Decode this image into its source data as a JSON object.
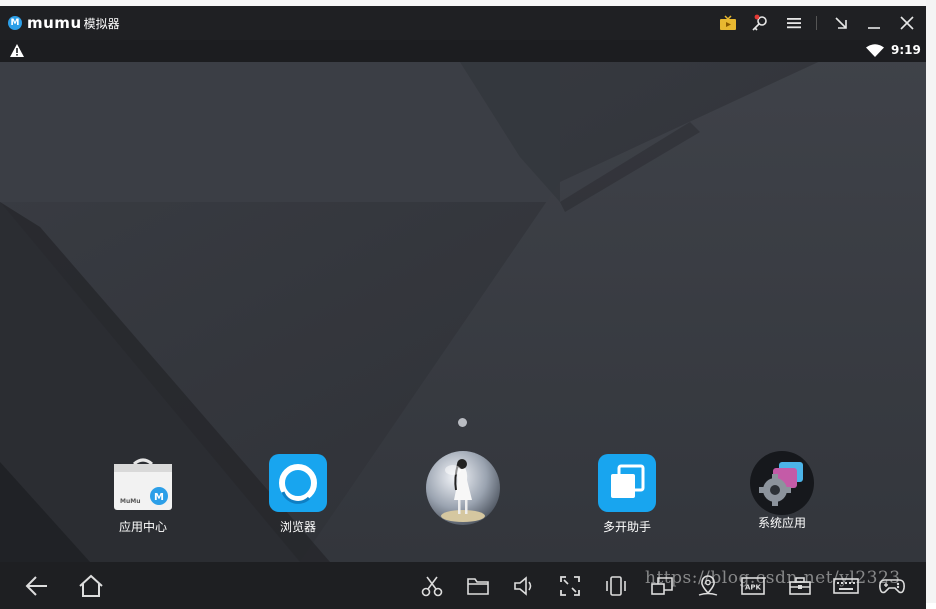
{
  "window": {
    "app_name": "mumu",
    "app_name_suffix": "模拟器",
    "titlebar_buttons": [
      "tv-icon",
      "key-icon",
      "menu-icon",
      "shrink-icon",
      "minimize-icon",
      "close-icon"
    ]
  },
  "statusbar": {
    "time": "9:19",
    "left_icon": "warning-icon",
    "right_icon": "wifi-icon"
  },
  "desktop": {
    "apps": [
      {
        "label": "应用中心",
        "icon": "app-center-icon"
      },
      {
        "label": "浏览器",
        "icon": "browser-icon"
      },
      {
        "label": "",
        "icon": "character-globe-icon"
      },
      {
        "label": "多开助手",
        "icon": "multi-open-icon"
      },
      {
        "label": "系统应用",
        "icon": "system-apps-icon"
      }
    ],
    "page_count": 1
  },
  "navbar": {
    "left": [
      "back-icon",
      "home-icon"
    ],
    "right": [
      "scissors-icon",
      "folder-icon",
      "volume-icon",
      "fullscreen-icon",
      "rotate-icon",
      "multi-window-icon",
      "location-icon",
      "apk-install-icon",
      "toolbox-icon",
      "keyboard-icon",
      "gamepad-icon"
    ]
  },
  "watermark": "https://blog.csdn.net/yl2323",
  "colors": {
    "accent": "#2c9fe8",
    "titlebar": "#1f2023",
    "navbar": "#1e1f22"
  }
}
